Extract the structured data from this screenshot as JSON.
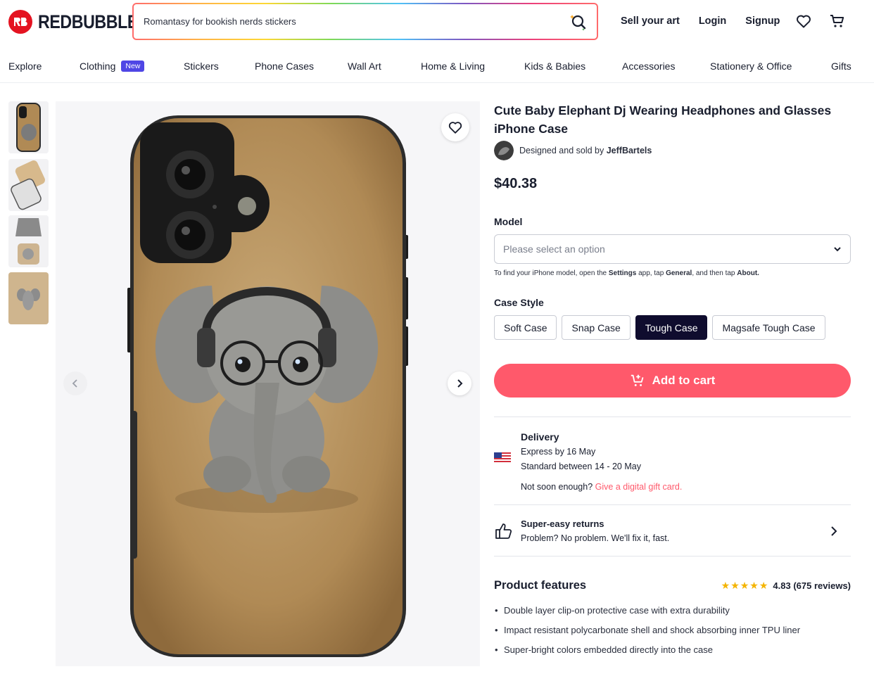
{
  "header": {
    "brand": "REDBUBBLE",
    "search_value": "Romantasy for bookish nerds stickers",
    "links": [
      "Sell your art",
      "Login",
      "Signup"
    ]
  },
  "nav": {
    "items": [
      "Explore",
      "Clothing",
      "Stickers",
      "Phone Cases",
      "Wall Art",
      "Home & Living",
      "Kids & Babies",
      "Accessories",
      "Stationery & Office",
      "Gifts"
    ],
    "clothing_badge": "New"
  },
  "product": {
    "title": "Cute Baby Elephant Dj Wearing Headphones and Glasses iPhone Case",
    "seller_prefix": "Designed and sold by",
    "seller_name": "JeffBartels",
    "price": "$40.38",
    "model_label": "Model",
    "model_placeholder": "Please select an option",
    "hint_1": "To find your iPhone model, open the",
    "hint_settings": "Settings",
    "hint_2": "app, tap",
    "hint_general": "General",
    "hint_3": ", and then tap",
    "hint_about": "About.",
    "case_style_label": "Case Style",
    "case_styles": [
      "Soft Case",
      "Snap Case",
      "Tough Case",
      "Magsafe Tough Case"
    ],
    "selected_style": "Tough Case",
    "add_to_cart": "Add to cart"
  },
  "delivery": {
    "title": "Delivery",
    "express": "Express by 16 May",
    "standard": "Standard between 14 - 20 May",
    "not_soon": "Not soon enough?",
    "gift_link": "Give a digital gift card."
  },
  "returns": {
    "title": "Super-easy returns",
    "subtitle": "Problem? No problem. We'll fix it, fast."
  },
  "features": {
    "title": "Product features",
    "stars": "★★★★★",
    "rating": "4.83 (675 reviews)",
    "items": [
      "Double layer clip-on protective case with extra durability",
      "Impact resistant polycarbonate shell and shock absorbing inner TPU liner",
      "Super-bright colors embedded directly into the case"
    ]
  },
  "colors": {
    "brand_red": "#e41321",
    "cart_pink": "#ff596b",
    "selected_navy": "#0f0c2e",
    "badge_indigo": "#4f46e5"
  }
}
